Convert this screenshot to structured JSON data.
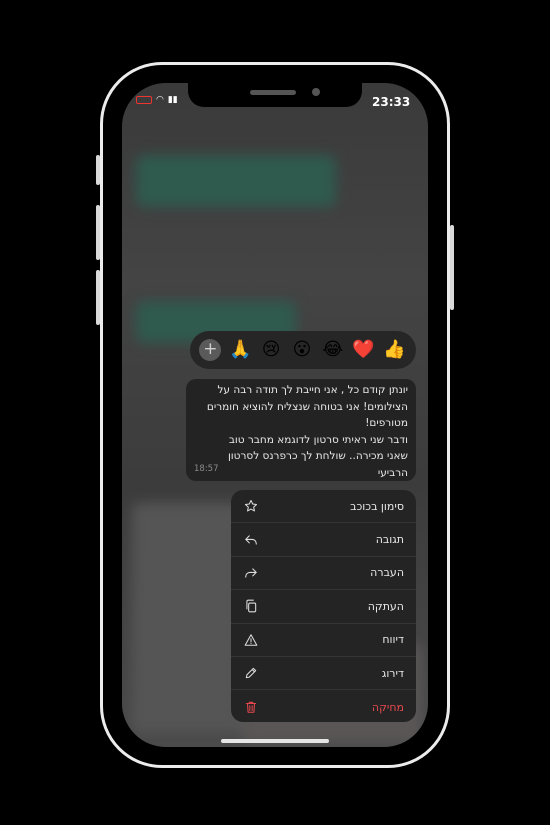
{
  "status_bar": {
    "time": "23:33"
  },
  "reactions": [
    {
      "emoji": "👍",
      "name": "thumbs-up-emoji"
    },
    {
      "emoji": "❤️",
      "name": "heart-emoji"
    },
    {
      "emoji": "😂",
      "name": "laughing-emoji"
    },
    {
      "emoji": "😮",
      "name": "surprised-emoji"
    },
    {
      "emoji": "😢",
      "name": "crying-emoji"
    },
    {
      "emoji": "🙏",
      "name": "praying-hands-emoji"
    }
  ],
  "reaction_more": "+",
  "message": {
    "line1": "יונתן קודם כל , אני חייבת לך תודה רבה על",
    "line2": "הצילומים! אני בטוחה שנצליח להוציא חומרים",
    "line3": "מטורפים!",
    "line4": "ודבר שני ראיתי סרטון לדוגמא מחבר טוב",
    "line5": "שאני מכירה.. שולחת לך כרפרנס לסרטון",
    "line6": "הרביעי",
    "time": "18:57"
  },
  "menu": {
    "star": "סימון בכוכב",
    "reply": "תגובה",
    "forward": "העברה",
    "copy": "העתקה",
    "report": "דיווח",
    "rate": "דירוג",
    "delete": "מחיקה"
  },
  "colors": {
    "danger": "#e5484d",
    "menu_bg": "#242424",
    "bubble_bg": "#232323"
  }
}
